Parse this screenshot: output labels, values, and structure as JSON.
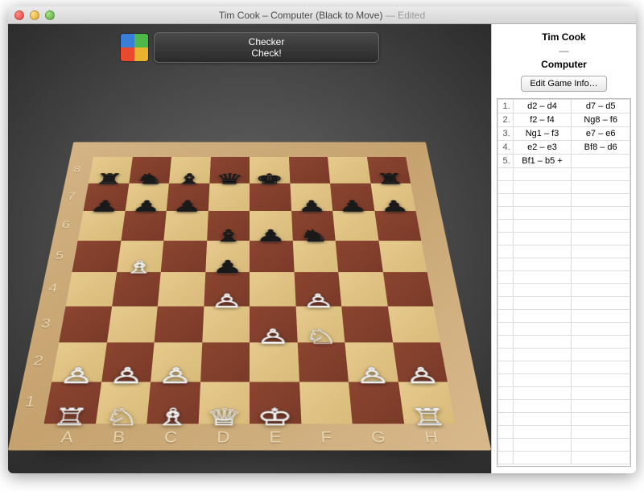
{
  "window": {
    "title_main": "Tim Cook – Computer   (Black to Move)",
    "title_edited": " — Edited"
  },
  "notification": {
    "line1": "Checker",
    "line2": "Check!"
  },
  "players": {
    "white": "Tim Cook",
    "vs": "—",
    "black": "Computer"
  },
  "buttons": {
    "edit_game": "Edit Game Info…"
  },
  "ranks": [
    "8",
    "7",
    "6",
    "5",
    "4",
    "3",
    "2",
    "1"
  ],
  "files": [
    "A",
    "B",
    "C",
    "D",
    "E",
    "F",
    "G",
    "H"
  ],
  "moves": [
    {
      "n": "1.",
      "w": "d2  –  d4",
      "b": "d7  –  d5"
    },
    {
      "n": "2.",
      "w": "f2  –  f4",
      "b": "Ng8  –  f6"
    },
    {
      "n": "3.",
      "w": "Ng1  –  f3",
      "b": "e7  –  e6"
    },
    {
      "n": "4.",
      "w": "e2  –  e3",
      "b": "Bf8  –  d6"
    },
    {
      "n": "5.",
      "w": "Bf1  –  b5 +",
      "b": ""
    }
  ],
  "piece_glyphs": {
    "K": "♔",
    "Q": "♕",
    "R": "♖",
    "B": "♗",
    "N": "♘",
    "P": "♙",
    "k": "♚",
    "q": "♛",
    "r": "♜",
    "b": "♝",
    "n": "♞",
    "p": "♟"
  },
  "position": [
    {
      "p": "r",
      "f": 0,
      "r": 7
    },
    {
      "p": "n",
      "f": 1,
      "r": 7
    },
    {
      "p": "b",
      "f": 2,
      "r": 7
    },
    {
      "p": "q",
      "f": 3,
      "r": 7
    },
    {
      "p": "k",
      "f": 4,
      "r": 7
    },
    {
      "p": "r",
      "f": 7,
      "r": 7
    },
    {
      "p": "p",
      "f": 0,
      "r": 6
    },
    {
      "p": "p",
      "f": 1,
      "r": 6
    },
    {
      "p": "p",
      "f": 2,
      "r": 6
    },
    {
      "p": "p",
      "f": 5,
      "r": 6
    },
    {
      "p": "p",
      "f": 6,
      "r": 6
    },
    {
      "p": "p",
      "f": 7,
      "r": 6
    },
    {
      "p": "b",
      "f": 3,
      "r": 5
    },
    {
      "p": "p",
      "f": 4,
      "r": 5
    },
    {
      "p": "n",
      "f": 5,
      "r": 5
    },
    {
      "p": "B",
      "f": 1,
      "r": 4
    },
    {
      "p": "p",
      "f": 3,
      "r": 4
    },
    {
      "p": "P",
      "f": 3,
      "r": 3
    },
    {
      "p": "P",
      "f": 5,
      "r": 3
    },
    {
      "p": "P",
      "f": 4,
      "r": 2
    },
    {
      "p": "N",
      "f": 5,
      "r": 2
    },
    {
      "p": "P",
      "f": 0,
      "r": 1
    },
    {
      "p": "P",
      "f": 1,
      "r": 1
    },
    {
      "p": "P",
      "f": 2,
      "r": 1
    },
    {
      "p": "P",
      "f": 6,
      "r": 1
    },
    {
      "p": "P",
      "f": 7,
      "r": 1
    },
    {
      "p": "R",
      "f": 0,
      "r": 0
    },
    {
      "p": "N",
      "f": 1,
      "r": 0
    },
    {
      "p": "B",
      "f": 2,
      "r": 0
    },
    {
      "p": "Q",
      "f": 3,
      "r": 0
    },
    {
      "p": "K",
      "f": 4,
      "r": 0
    },
    {
      "p": "R",
      "f": 7,
      "r": 0
    }
  ],
  "colors": {
    "light_square": "#e2c588",
    "dark_square": "#8b4530"
  }
}
